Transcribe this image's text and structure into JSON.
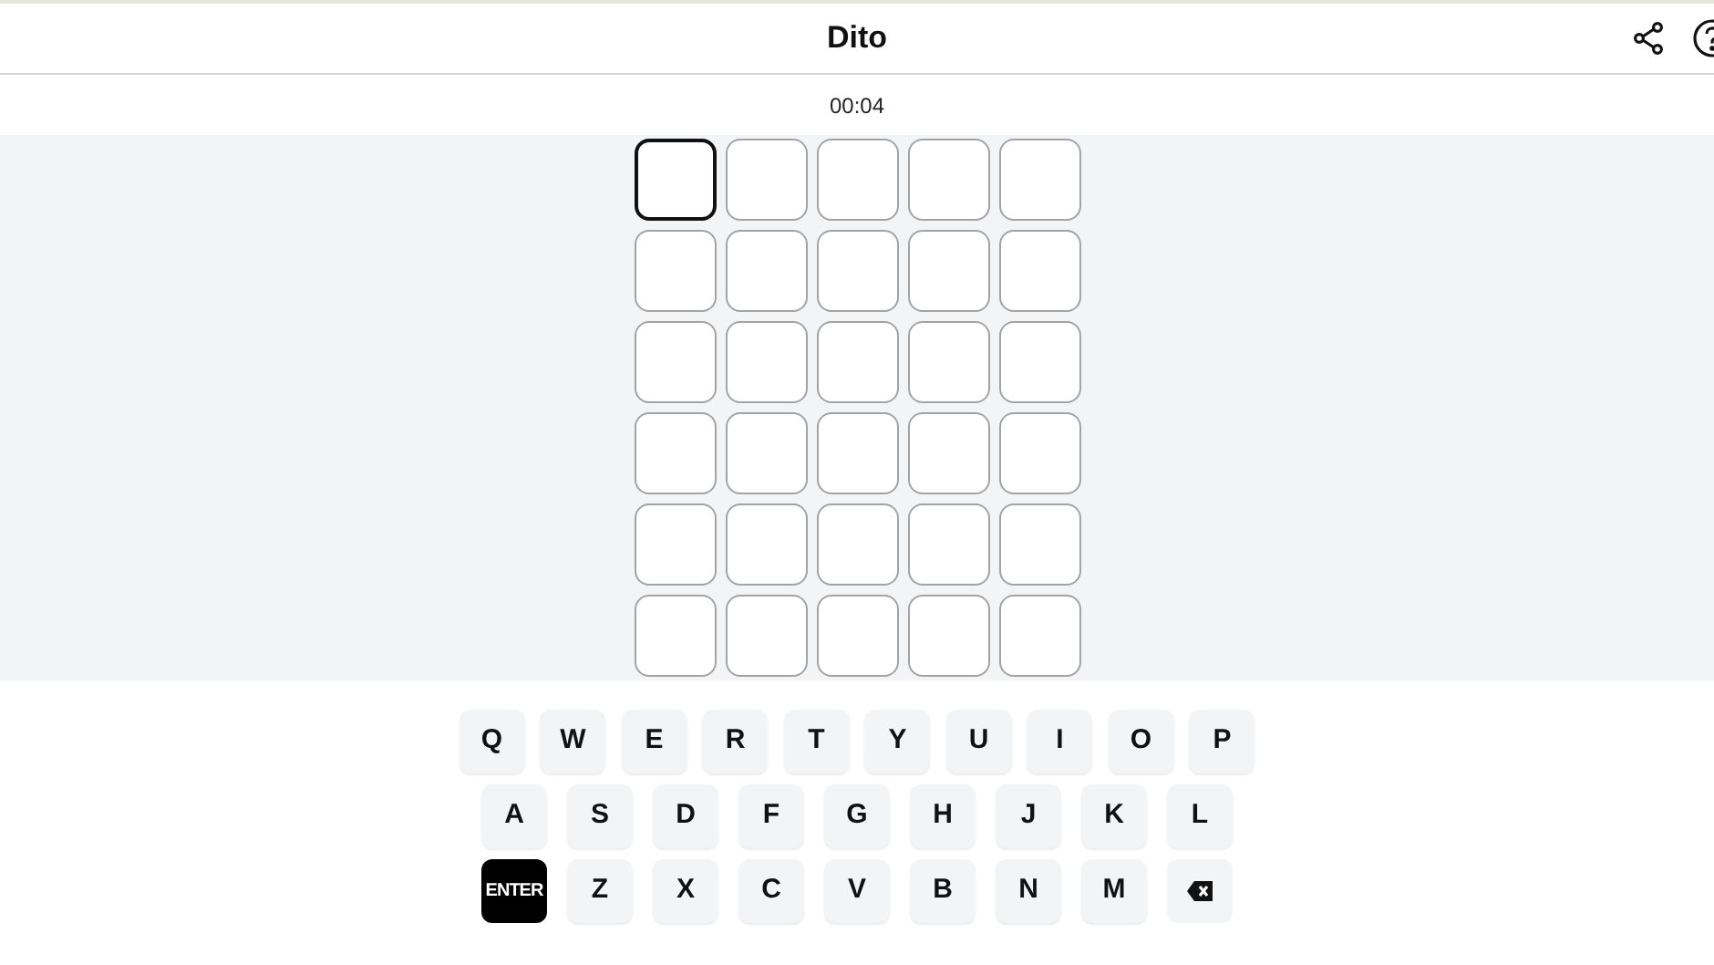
{
  "header": {
    "title": "Dito"
  },
  "timer": "00:04",
  "grid": [
    [
      {
        "selected": true
      },
      {
        "selected": false
      },
      {
        "selected": false
      },
      {
        "selected": false
      },
      {
        "selected": false
      }
    ],
    [
      {
        "selected": false
      },
      {
        "selected": false
      },
      {
        "selected": false
      },
      {
        "selected": false
      },
      {
        "selected": false
      }
    ],
    [
      {
        "selected": false
      },
      {
        "selected": false
      },
      {
        "selected": false
      },
      {
        "selected": false
      },
      {
        "selected": false
      }
    ],
    [
      {
        "selected": false
      },
      {
        "selected": false
      },
      {
        "selected": false
      },
      {
        "selected": false
      },
      {
        "selected": false
      }
    ],
    [
      {
        "selected": false
      },
      {
        "selected": false
      },
      {
        "selected": false
      },
      {
        "selected": false
      },
      {
        "selected": false
      }
    ],
    [
      {
        "selected": false
      },
      {
        "selected": false
      },
      {
        "selected": false
      },
      {
        "selected": false
      },
      {
        "selected": false
      }
    ]
  ],
  "keyboard": [
    [
      {
        "kind": "letter",
        "label": "Q"
      },
      {
        "kind": "letter",
        "label": "W"
      },
      {
        "kind": "letter",
        "label": "E"
      },
      {
        "kind": "letter",
        "label": "R"
      },
      {
        "kind": "letter",
        "label": "T"
      },
      {
        "kind": "letter",
        "label": "Y"
      },
      {
        "kind": "letter",
        "label": "U"
      },
      {
        "kind": "letter",
        "label": "I"
      },
      {
        "kind": "letter",
        "label": "O"
      },
      {
        "kind": "letter",
        "label": "P"
      }
    ],
    [
      {
        "kind": "letter",
        "label": "A"
      },
      {
        "kind": "letter",
        "label": "S"
      },
      {
        "kind": "letter",
        "label": "D"
      },
      {
        "kind": "letter",
        "label": "F"
      },
      {
        "kind": "letter",
        "label": "G"
      },
      {
        "kind": "letter",
        "label": "H"
      },
      {
        "kind": "letter",
        "label": "J"
      },
      {
        "kind": "letter",
        "label": "K"
      },
      {
        "kind": "letter",
        "label": "L"
      }
    ],
    [
      {
        "kind": "enter",
        "label": "ENTER"
      },
      {
        "kind": "letter",
        "label": "Z"
      },
      {
        "kind": "letter",
        "label": "X"
      },
      {
        "kind": "letter",
        "label": "C"
      },
      {
        "kind": "letter",
        "label": "V"
      },
      {
        "kind": "letter",
        "label": "B"
      },
      {
        "kind": "letter",
        "label": "N"
      },
      {
        "kind": "letter",
        "label": "M"
      },
      {
        "kind": "backspace"
      }
    ]
  ]
}
